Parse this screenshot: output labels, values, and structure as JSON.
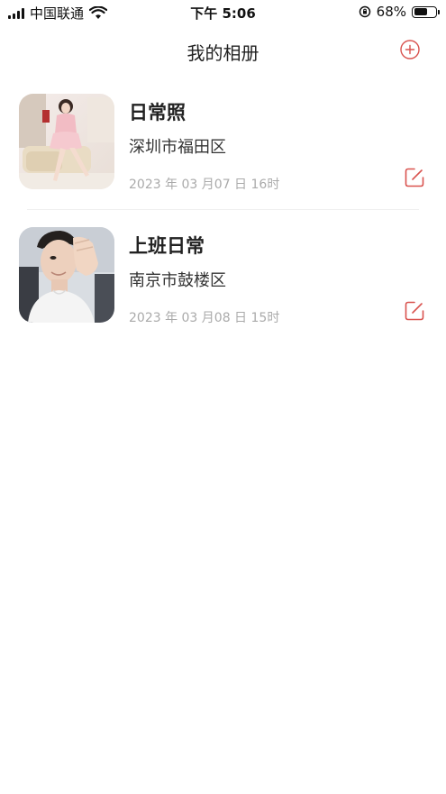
{
  "status_bar": {
    "carrier": "中国联通",
    "time": "下午 5:06",
    "battery_percent": "68%",
    "battery_level": 0.68,
    "icons": [
      "signal-icon",
      "wifi-icon",
      "orientation-lock-icon",
      "battery-icon"
    ]
  },
  "nav": {
    "title": "我的相册",
    "add_icon": "plus-circle-icon"
  },
  "colors": {
    "accent": "#d9534f",
    "text_primary": "#222222",
    "text_secondary": "#333333",
    "text_muted": "#aaaaaa",
    "divider": "#efefef"
  },
  "albums": [
    {
      "name": "日常照",
      "location": "深圳市福田区",
      "date": "2023 年 03 月07 日 16时",
      "cover": "photo-woman-sitting-pink-outfit",
      "edit_icon": "edit-icon"
    },
    {
      "name": "上班日常",
      "location": "南京市鼓楼区",
      "date": "2023 年 03 月08 日 15时",
      "cover": "photo-young-man-selfie",
      "edit_icon": "edit-icon"
    }
  ]
}
